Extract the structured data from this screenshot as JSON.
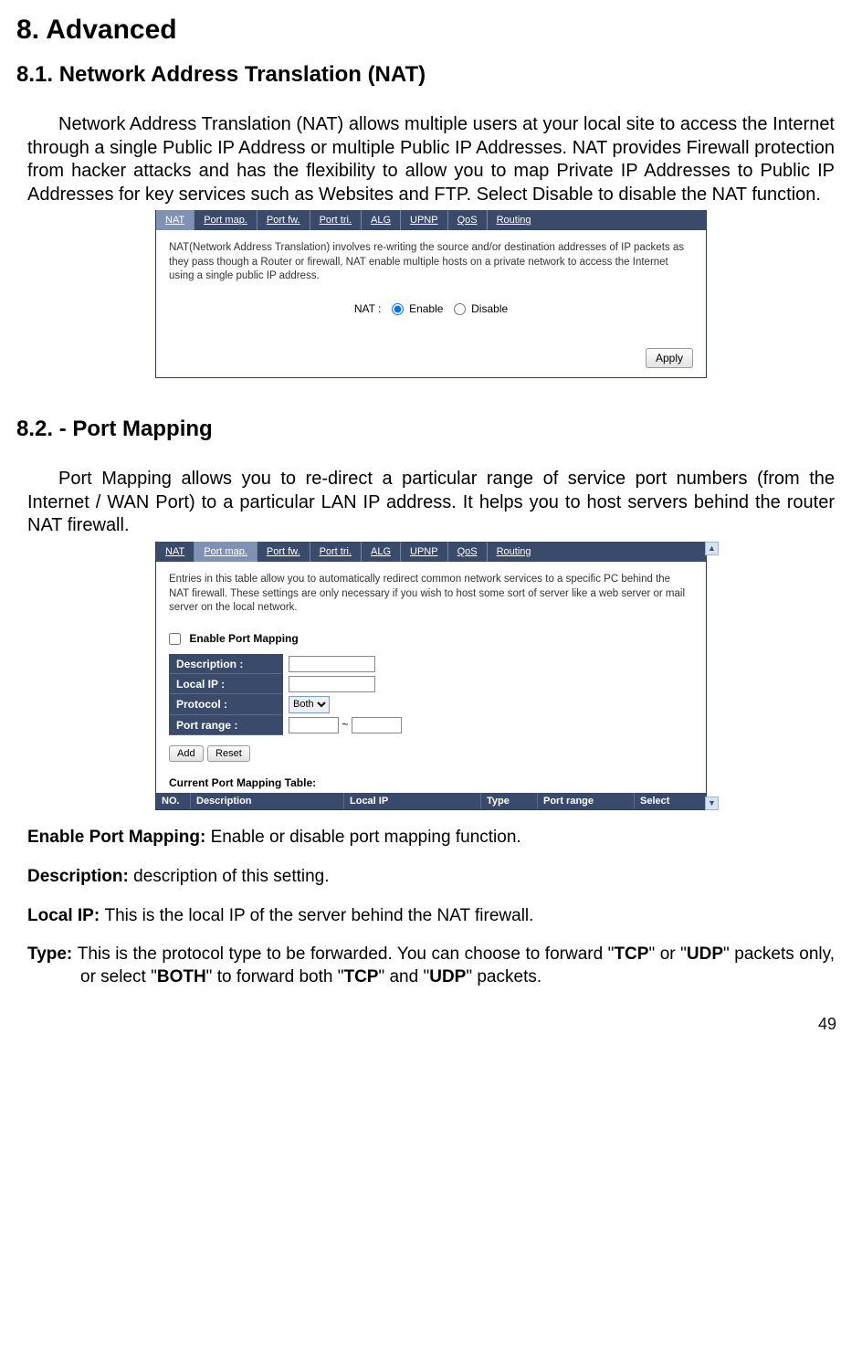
{
  "headings": {
    "h1": "8. Advanced",
    "h2a": "8.1. Network Address Translation (NAT)",
    "h2b": "8.2. - Port Mapping"
  },
  "para": {
    "nat_intro": "Network Address Translation (NAT) allows multiple users at your local site to access the Internet through a single Public IP Address or multiple Public IP Addresses. NAT provides Firewall protection from hacker attacks and has the flexibility to allow you to map Private IP Addresses to Public IP Addresses for key services such as Websites and FTP. Select Disable to disable the NAT function.",
    "pm_intro": "Port Mapping allows you to re-direct a particular range of service port numbers (from the Internet / WAN Port) to a particular LAN IP address. It helps you to host servers behind the router NAT firewall."
  },
  "tabs": [
    "NAT",
    "Port map.",
    "Port fw.",
    "Port tri.",
    "ALG",
    "UPNP",
    "QoS",
    "Routing"
  ],
  "shot1": {
    "desc": "NAT(Network Address Translation) involves re-writing the source and/or destination addresses of IP packets as they pass though a Router or firewall, NAT enable multiple hosts on a private network to access the Internet using a single public IP address.",
    "label": "NAT :",
    "enable": "Enable",
    "disable": "Disable",
    "apply": "Apply"
  },
  "shot2": {
    "desc": "Entries in this table allow you to automatically redirect common network services to a specific PC behind the NAT firewall. These settings are only necessary if you wish to host some sort of server like a web server or mail server on the local network.",
    "enable_label": "Enable Port Mapping",
    "rows": {
      "description": "Description :",
      "local_ip": "Local IP :",
      "protocol": "Protocol :",
      "protocol_value": "Both",
      "port_range": "Port range :",
      "tilde": "~"
    },
    "buttons": {
      "add": "Add",
      "reset": "Reset"
    },
    "current": "Current Port Mapping Table:",
    "cols": [
      "NO.",
      "Description",
      "Local IP",
      "Type",
      "Port range",
      "Select"
    ]
  },
  "defs": {
    "enable": {
      "term": "Enable Port Mapping: ",
      "text": "Enable or disable port mapping function."
    },
    "desc": {
      "term": "Description: ",
      "text": "description of this setting."
    },
    "local": {
      "term": "Local IP: ",
      "text": "This is the local IP of the server behind the NAT firewall."
    },
    "type_term": "Type: ",
    "type_p1": "This is the protocol type to be forwarded. You can choose to forward \"",
    "type_tcp": "TCP",
    "type_p2": "\" or \"",
    "type_udp": "UDP",
    "type_p3": "\" packets only, or select \"",
    "type_both": "BOTH",
    "type_p4": "\" to forward both \"",
    "type_p5": "\" and \"",
    "type_p6": "\" packets."
  },
  "page_number": "49"
}
